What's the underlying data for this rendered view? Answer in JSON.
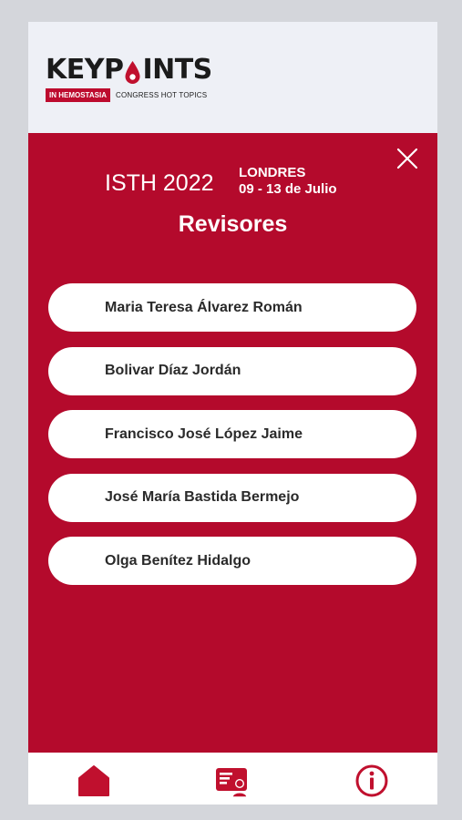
{
  "header": {
    "logo_word": "KEYPOINTS",
    "logo_tag": "IN HEMOSTASIA",
    "logo_subtitle": "CONGRESS HOT TOPICS"
  },
  "event": {
    "title": "ISTH 2022",
    "city": "LONDRES",
    "dates": "09 - 13 de Julio"
  },
  "section_title": "Revisores",
  "reviewers": [
    "Maria Teresa Álvarez Román",
    "Bolivar Díaz Jordán",
    "Francisco José López Jaime",
    "José María Bastida Bermejo",
    "Olga Benítez Hidalgo"
  ],
  "nav": [
    "home-icon",
    "id-card-icon",
    "info-icon"
  ],
  "colors": {
    "brand_red": "#b40a2c",
    "header_bg": "#eef0f6",
    "nav_icon": "#c0102e"
  }
}
